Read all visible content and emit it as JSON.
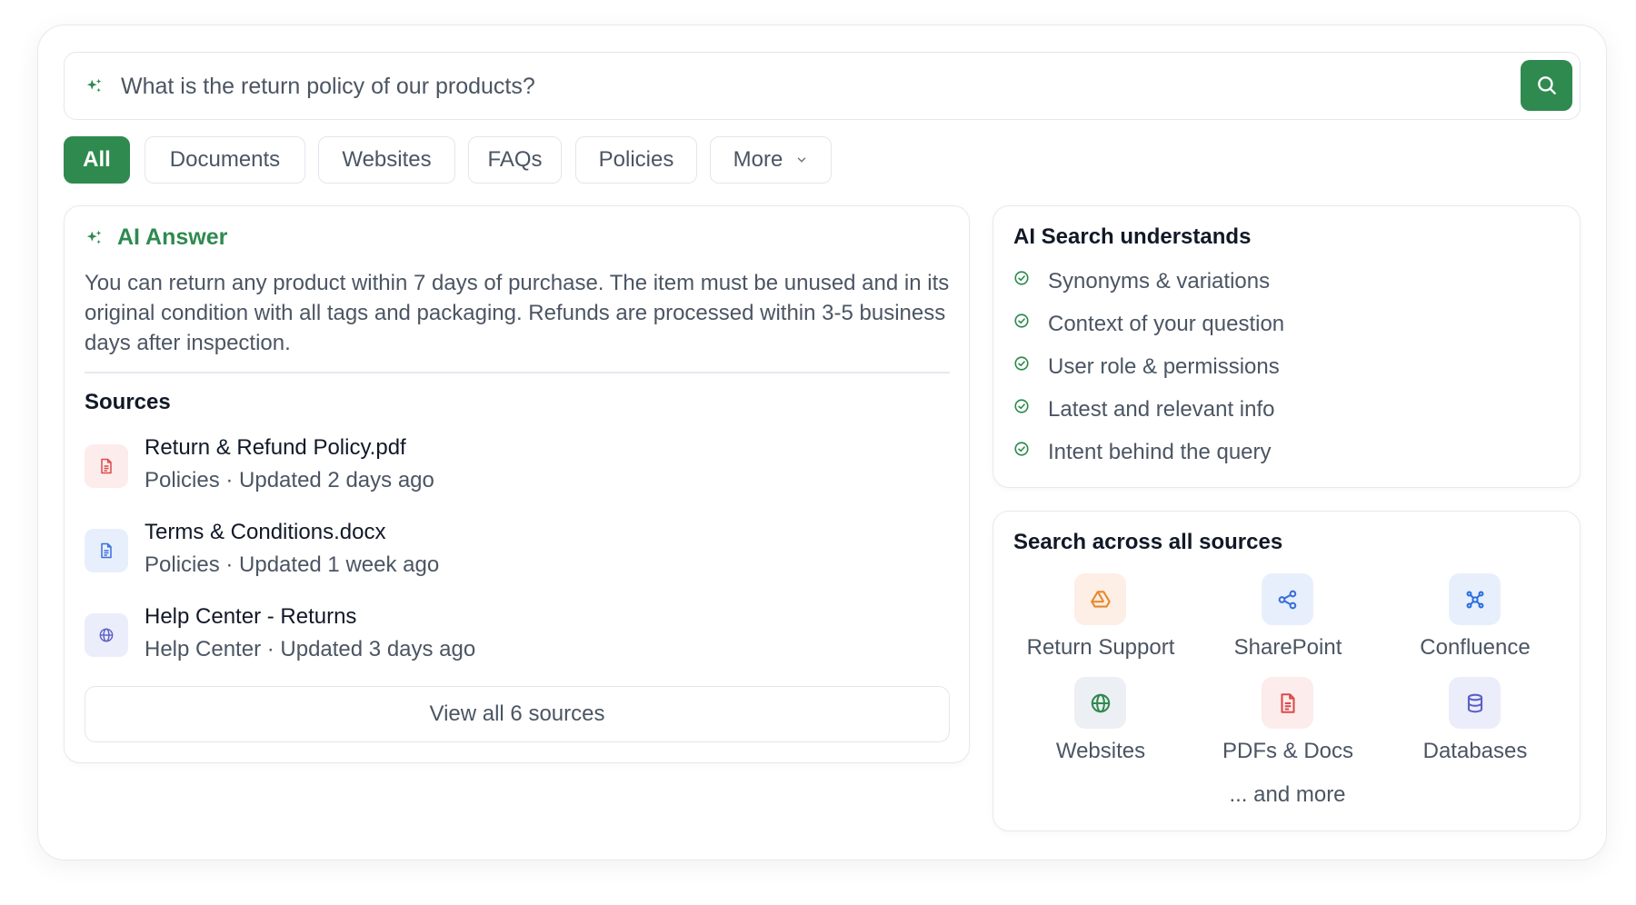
{
  "search": {
    "value": "What is the return policy of our products?",
    "placeholder": "What is the return policy of our products?"
  },
  "filters": [
    {
      "label": "All",
      "active": true
    },
    {
      "label": "Documents",
      "active": false
    },
    {
      "label": "Websites",
      "active": false
    },
    {
      "label": "FAQs",
      "active": false
    },
    {
      "label": "Policies",
      "active": false
    },
    {
      "label": "More",
      "active": false
    }
  ],
  "ai_answer": {
    "title": "AI Answer",
    "text": "You can return any product within 7 days of purchase. The item must be unused and in its original condition with all tags and packaging. Refunds are processed within 3-5 business days after inspection."
  },
  "sources": {
    "title": "Sources",
    "items": [
      {
        "name": "Return & Refund Policy.pdf",
        "meta": "Policies · Updated 2 days ago",
        "icon": "pdf-file-icon"
      },
      {
        "name": "Terms & Conditions.docx",
        "meta": "Policies · Updated 1 week ago",
        "icon": "doc-file-icon"
      },
      {
        "name": "Help Center - Returns",
        "meta": "Help Center · Updated 3 days ago",
        "icon": "globe-icon"
      }
    ],
    "view_all_label": "View all 6 sources"
  },
  "understands": {
    "title": "AI Search understands",
    "items": [
      "Synonyms & variations",
      "Context of your question",
      "User role & permissions",
      "Latest and relevant info",
      "Intent behind the query"
    ]
  },
  "all_sources": {
    "title": "Search across all sources",
    "items": [
      {
        "label": "Return Support",
        "icon": "drive-icon"
      },
      {
        "label": "SharePoint",
        "icon": "share-nodes-icon"
      },
      {
        "label": "Confluence",
        "icon": "confluence-icon"
      },
      {
        "label": "Websites",
        "icon": "globe-icon"
      },
      {
        "label": "PDFs & Docs",
        "icon": "pdf-doc-icon"
      },
      {
        "label": "Databases",
        "icon": "database-icon"
      }
    ],
    "more_label": "... and more"
  },
  "colors": {
    "accent": "#2f8a4f",
    "pdf_red": "#dc4a4a",
    "doc_blue": "#3b6fd8",
    "globe_purple": "#5b5fc7"
  }
}
